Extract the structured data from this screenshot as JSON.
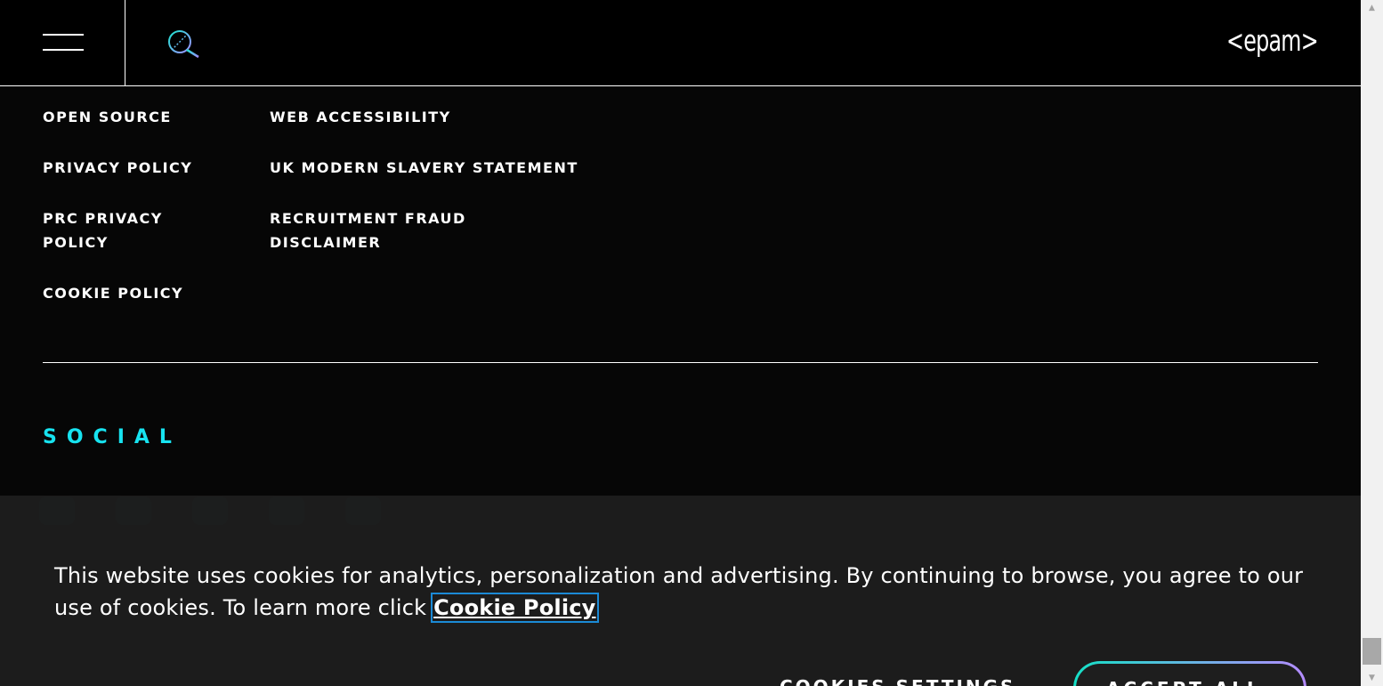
{
  "header": {
    "logo_text": "<epam>",
    "menu_icon": "hamburger-menu-icon",
    "search_icon": "search-icon"
  },
  "footer": {
    "links_col1": [
      "OPEN SOURCE",
      "PRIVACY POLICY",
      "PRC PRIVACY POLICY",
      "COOKIE POLICY"
    ],
    "links_col2": [
      "WEB ACCESSIBILITY",
      "UK MODERN SLAVERY STATEMENT",
      "RECRUITMENT FRAUD DISCLAIMER"
    ],
    "social_title": "SOCIAL"
  },
  "cookie_banner": {
    "text": "This website uses cookies for analytics, personalization and advertising. By continuing to browse, you agree to our use of cookies. To learn more click ",
    "link_label": "Cookie Policy",
    "settings_label": "COOKIES SETTINGS",
    "accept_label": "ACCEPT ALL"
  },
  "colors": {
    "accent": "#17e3f0",
    "background": "#060606",
    "banner": "#1e1e1e",
    "focus_outline": "#1b8ad6"
  }
}
